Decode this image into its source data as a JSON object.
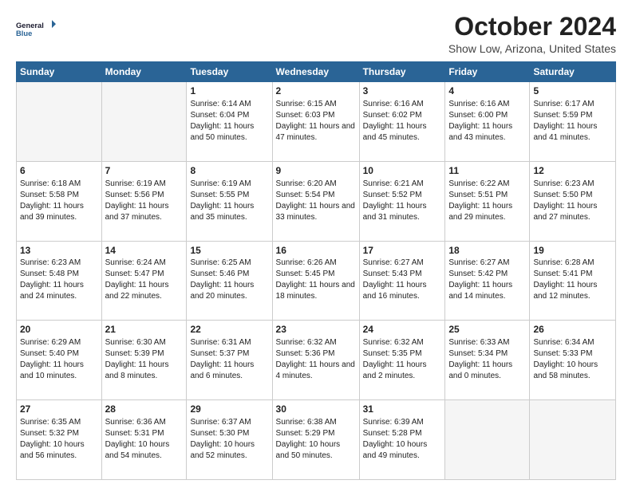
{
  "logo": {
    "line1": "General",
    "line2": "Blue"
  },
  "title": "October 2024",
  "location": "Show Low, Arizona, United States",
  "days_of_week": [
    "Sunday",
    "Monday",
    "Tuesday",
    "Wednesday",
    "Thursday",
    "Friday",
    "Saturday"
  ],
  "weeks": [
    [
      {
        "num": "",
        "detail": ""
      },
      {
        "num": "",
        "detail": ""
      },
      {
        "num": "1",
        "detail": "Sunrise: 6:14 AM\nSunset: 6:04 PM\nDaylight: 11 hours and 50 minutes."
      },
      {
        "num": "2",
        "detail": "Sunrise: 6:15 AM\nSunset: 6:03 PM\nDaylight: 11 hours and 47 minutes."
      },
      {
        "num": "3",
        "detail": "Sunrise: 6:16 AM\nSunset: 6:02 PM\nDaylight: 11 hours and 45 minutes."
      },
      {
        "num": "4",
        "detail": "Sunrise: 6:16 AM\nSunset: 6:00 PM\nDaylight: 11 hours and 43 minutes."
      },
      {
        "num": "5",
        "detail": "Sunrise: 6:17 AM\nSunset: 5:59 PM\nDaylight: 11 hours and 41 minutes."
      }
    ],
    [
      {
        "num": "6",
        "detail": "Sunrise: 6:18 AM\nSunset: 5:58 PM\nDaylight: 11 hours and 39 minutes."
      },
      {
        "num": "7",
        "detail": "Sunrise: 6:19 AM\nSunset: 5:56 PM\nDaylight: 11 hours and 37 minutes."
      },
      {
        "num": "8",
        "detail": "Sunrise: 6:19 AM\nSunset: 5:55 PM\nDaylight: 11 hours and 35 minutes."
      },
      {
        "num": "9",
        "detail": "Sunrise: 6:20 AM\nSunset: 5:54 PM\nDaylight: 11 hours and 33 minutes."
      },
      {
        "num": "10",
        "detail": "Sunrise: 6:21 AM\nSunset: 5:52 PM\nDaylight: 11 hours and 31 minutes."
      },
      {
        "num": "11",
        "detail": "Sunrise: 6:22 AM\nSunset: 5:51 PM\nDaylight: 11 hours and 29 minutes."
      },
      {
        "num": "12",
        "detail": "Sunrise: 6:23 AM\nSunset: 5:50 PM\nDaylight: 11 hours and 27 minutes."
      }
    ],
    [
      {
        "num": "13",
        "detail": "Sunrise: 6:23 AM\nSunset: 5:48 PM\nDaylight: 11 hours and 24 minutes."
      },
      {
        "num": "14",
        "detail": "Sunrise: 6:24 AM\nSunset: 5:47 PM\nDaylight: 11 hours and 22 minutes."
      },
      {
        "num": "15",
        "detail": "Sunrise: 6:25 AM\nSunset: 5:46 PM\nDaylight: 11 hours and 20 minutes."
      },
      {
        "num": "16",
        "detail": "Sunrise: 6:26 AM\nSunset: 5:45 PM\nDaylight: 11 hours and 18 minutes."
      },
      {
        "num": "17",
        "detail": "Sunrise: 6:27 AM\nSunset: 5:43 PM\nDaylight: 11 hours and 16 minutes."
      },
      {
        "num": "18",
        "detail": "Sunrise: 6:27 AM\nSunset: 5:42 PM\nDaylight: 11 hours and 14 minutes."
      },
      {
        "num": "19",
        "detail": "Sunrise: 6:28 AM\nSunset: 5:41 PM\nDaylight: 11 hours and 12 minutes."
      }
    ],
    [
      {
        "num": "20",
        "detail": "Sunrise: 6:29 AM\nSunset: 5:40 PM\nDaylight: 11 hours and 10 minutes."
      },
      {
        "num": "21",
        "detail": "Sunrise: 6:30 AM\nSunset: 5:39 PM\nDaylight: 11 hours and 8 minutes."
      },
      {
        "num": "22",
        "detail": "Sunrise: 6:31 AM\nSunset: 5:37 PM\nDaylight: 11 hours and 6 minutes."
      },
      {
        "num": "23",
        "detail": "Sunrise: 6:32 AM\nSunset: 5:36 PM\nDaylight: 11 hours and 4 minutes."
      },
      {
        "num": "24",
        "detail": "Sunrise: 6:32 AM\nSunset: 5:35 PM\nDaylight: 11 hours and 2 minutes."
      },
      {
        "num": "25",
        "detail": "Sunrise: 6:33 AM\nSunset: 5:34 PM\nDaylight: 11 hours and 0 minutes."
      },
      {
        "num": "26",
        "detail": "Sunrise: 6:34 AM\nSunset: 5:33 PM\nDaylight: 10 hours and 58 minutes."
      }
    ],
    [
      {
        "num": "27",
        "detail": "Sunrise: 6:35 AM\nSunset: 5:32 PM\nDaylight: 10 hours and 56 minutes."
      },
      {
        "num": "28",
        "detail": "Sunrise: 6:36 AM\nSunset: 5:31 PM\nDaylight: 10 hours and 54 minutes."
      },
      {
        "num": "29",
        "detail": "Sunrise: 6:37 AM\nSunset: 5:30 PM\nDaylight: 10 hours and 52 minutes."
      },
      {
        "num": "30",
        "detail": "Sunrise: 6:38 AM\nSunset: 5:29 PM\nDaylight: 10 hours and 50 minutes."
      },
      {
        "num": "31",
        "detail": "Sunrise: 6:39 AM\nSunset: 5:28 PM\nDaylight: 10 hours and 49 minutes."
      },
      {
        "num": "",
        "detail": ""
      },
      {
        "num": "",
        "detail": ""
      }
    ]
  ]
}
